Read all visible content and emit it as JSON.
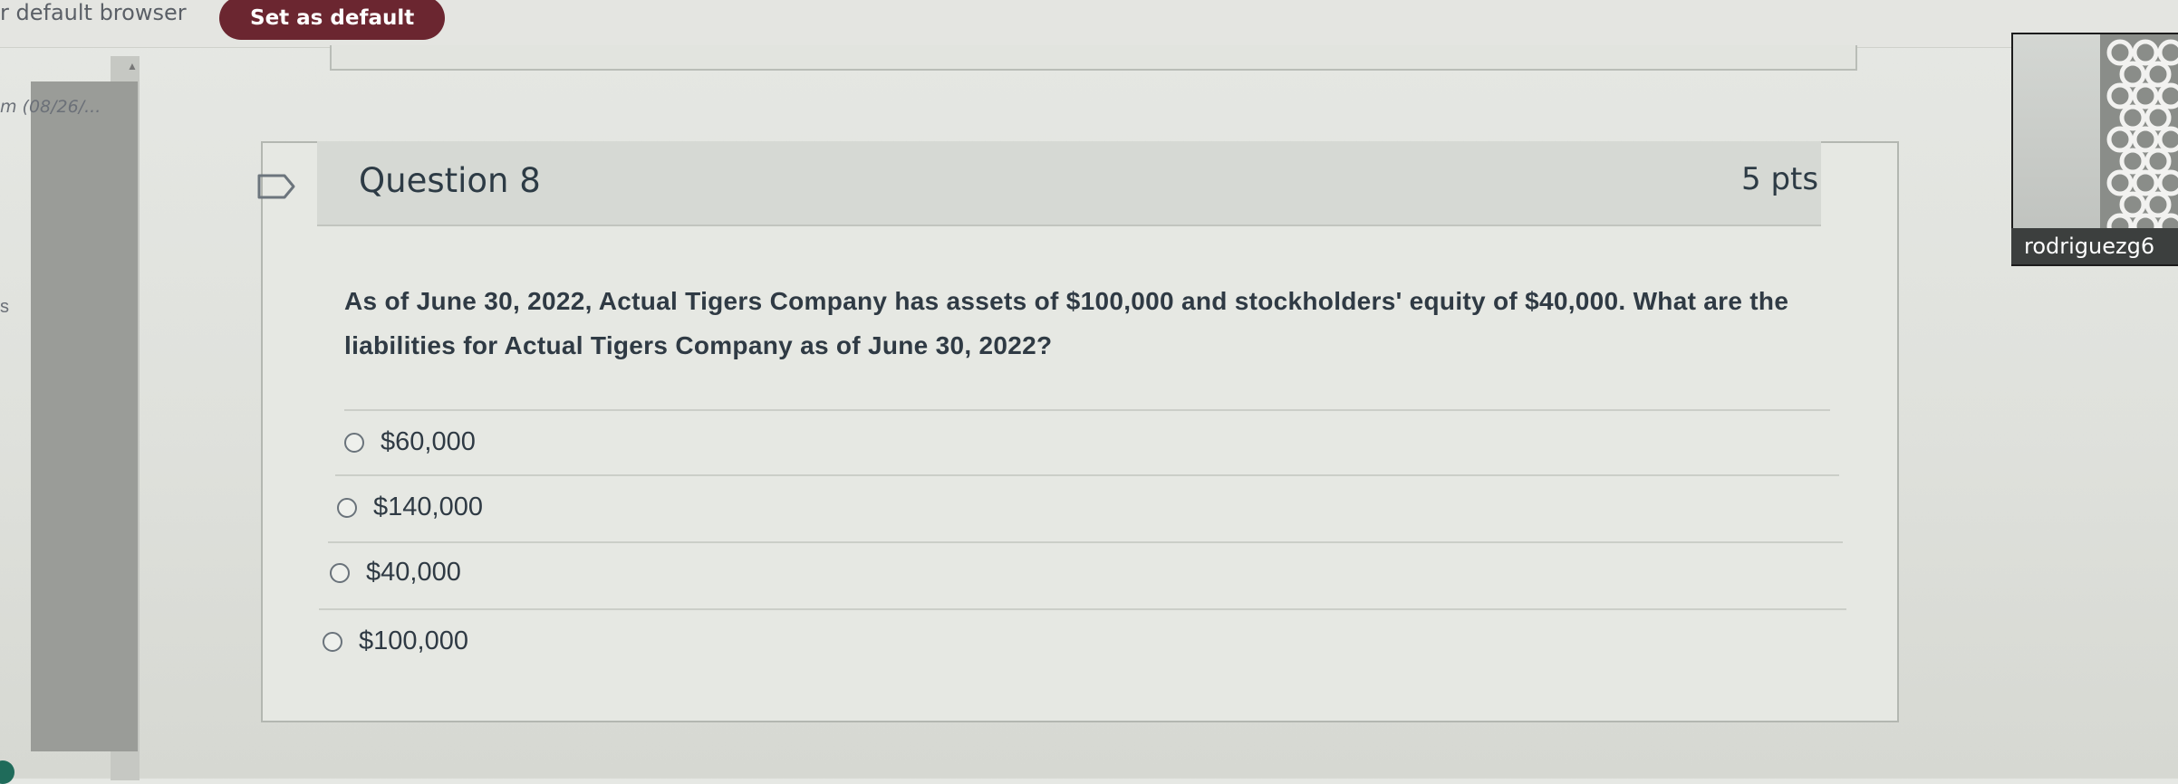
{
  "banner": {
    "text": "r default browser",
    "set_default_label": "Set as default"
  },
  "nav": {
    "date_text": "m (08/26/...",
    "letter": "s"
  },
  "question": {
    "title": "Question 8",
    "points": "5 pts",
    "text": "As of June 30, 2022, Actual Tigers Company has assets of $100,000 and stockholders' equity of $40,000. What are the liabilities for Actual Tigers Company as of June 30, 2022?",
    "answers": [
      "$60,000",
      "$140,000",
      "$40,000",
      "$100,000"
    ]
  },
  "webcam": {
    "username": "rodriguezg6"
  },
  "colors": {
    "button": "#6b2630",
    "accent_dot": "#1f6b5a"
  }
}
